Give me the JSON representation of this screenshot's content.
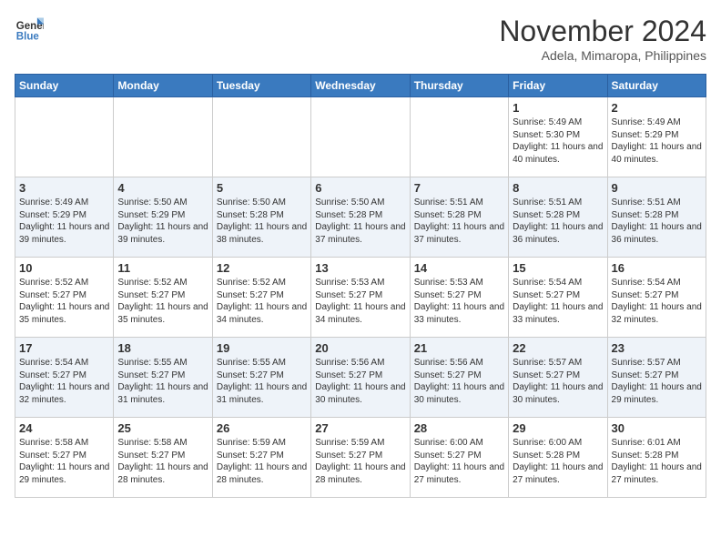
{
  "header": {
    "logo_line1": "General",
    "logo_line2": "Blue",
    "month": "November 2024",
    "location": "Adela, Mimaropa, Philippines"
  },
  "weekdays": [
    "Sunday",
    "Monday",
    "Tuesday",
    "Wednesday",
    "Thursday",
    "Friday",
    "Saturday"
  ],
  "weeks": [
    [
      {
        "day": "",
        "text": ""
      },
      {
        "day": "",
        "text": ""
      },
      {
        "day": "",
        "text": ""
      },
      {
        "day": "",
        "text": ""
      },
      {
        "day": "",
        "text": ""
      },
      {
        "day": "1",
        "text": "Sunrise: 5:49 AM\nSunset: 5:30 PM\nDaylight: 11 hours and 40 minutes."
      },
      {
        "day": "2",
        "text": "Sunrise: 5:49 AM\nSunset: 5:29 PM\nDaylight: 11 hours and 40 minutes."
      }
    ],
    [
      {
        "day": "3",
        "text": "Sunrise: 5:49 AM\nSunset: 5:29 PM\nDaylight: 11 hours and 39 minutes."
      },
      {
        "day": "4",
        "text": "Sunrise: 5:50 AM\nSunset: 5:29 PM\nDaylight: 11 hours and 39 minutes."
      },
      {
        "day": "5",
        "text": "Sunrise: 5:50 AM\nSunset: 5:28 PM\nDaylight: 11 hours and 38 minutes."
      },
      {
        "day": "6",
        "text": "Sunrise: 5:50 AM\nSunset: 5:28 PM\nDaylight: 11 hours and 37 minutes."
      },
      {
        "day": "7",
        "text": "Sunrise: 5:51 AM\nSunset: 5:28 PM\nDaylight: 11 hours and 37 minutes."
      },
      {
        "day": "8",
        "text": "Sunrise: 5:51 AM\nSunset: 5:28 PM\nDaylight: 11 hours and 36 minutes."
      },
      {
        "day": "9",
        "text": "Sunrise: 5:51 AM\nSunset: 5:28 PM\nDaylight: 11 hours and 36 minutes."
      }
    ],
    [
      {
        "day": "10",
        "text": "Sunrise: 5:52 AM\nSunset: 5:27 PM\nDaylight: 11 hours and 35 minutes."
      },
      {
        "day": "11",
        "text": "Sunrise: 5:52 AM\nSunset: 5:27 PM\nDaylight: 11 hours and 35 minutes."
      },
      {
        "day": "12",
        "text": "Sunrise: 5:52 AM\nSunset: 5:27 PM\nDaylight: 11 hours and 34 minutes."
      },
      {
        "day": "13",
        "text": "Sunrise: 5:53 AM\nSunset: 5:27 PM\nDaylight: 11 hours and 34 minutes."
      },
      {
        "day": "14",
        "text": "Sunrise: 5:53 AM\nSunset: 5:27 PM\nDaylight: 11 hours and 33 minutes."
      },
      {
        "day": "15",
        "text": "Sunrise: 5:54 AM\nSunset: 5:27 PM\nDaylight: 11 hours and 33 minutes."
      },
      {
        "day": "16",
        "text": "Sunrise: 5:54 AM\nSunset: 5:27 PM\nDaylight: 11 hours and 32 minutes."
      }
    ],
    [
      {
        "day": "17",
        "text": "Sunrise: 5:54 AM\nSunset: 5:27 PM\nDaylight: 11 hours and 32 minutes."
      },
      {
        "day": "18",
        "text": "Sunrise: 5:55 AM\nSunset: 5:27 PM\nDaylight: 11 hours and 31 minutes."
      },
      {
        "day": "19",
        "text": "Sunrise: 5:55 AM\nSunset: 5:27 PM\nDaylight: 11 hours and 31 minutes."
      },
      {
        "day": "20",
        "text": "Sunrise: 5:56 AM\nSunset: 5:27 PM\nDaylight: 11 hours and 30 minutes."
      },
      {
        "day": "21",
        "text": "Sunrise: 5:56 AM\nSunset: 5:27 PM\nDaylight: 11 hours and 30 minutes."
      },
      {
        "day": "22",
        "text": "Sunrise: 5:57 AM\nSunset: 5:27 PM\nDaylight: 11 hours and 30 minutes."
      },
      {
        "day": "23",
        "text": "Sunrise: 5:57 AM\nSunset: 5:27 PM\nDaylight: 11 hours and 29 minutes."
      }
    ],
    [
      {
        "day": "24",
        "text": "Sunrise: 5:58 AM\nSunset: 5:27 PM\nDaylight: 11 hours and 29 minutes."
      },
      {
        "day": "25",
        "text": "Sunrise: 5:58 AM\nSunset: 5:27 PM\nDaylight: 11 hours and 28 minutes."
      },
      {
        "day": "26",
        "text": "Sunrise: 5:59 AM\nSunset: 5:27 PM\nDaylight: 11 hours and 28 minutes."
      },
      {
        "day": "27",
        "text": "Sunrise: 5:59 AM\nSunset: 5:27 PM\nDaylight: 11 hours and 28 minutes."
      },
      {
        "day": "28",
        "text": "Sunrise: 6:00 AM\nSunset: 5:27 PM\nDaylight: 11 hours and 27 minutes."
      },
      {
        "day": "29",
        "text": "Sunrise: 6:00 AM\nSunset: 5:28 PM\nDaylight: 11 hours and 27 minutes."
      },
      {
        "day": "30",
        "text": "Sunrise: 6:01 AM\nSunset: 5:28 PM\nDaylight: 11 hours and 27 minutes."
      }
    ]
  ]
}
